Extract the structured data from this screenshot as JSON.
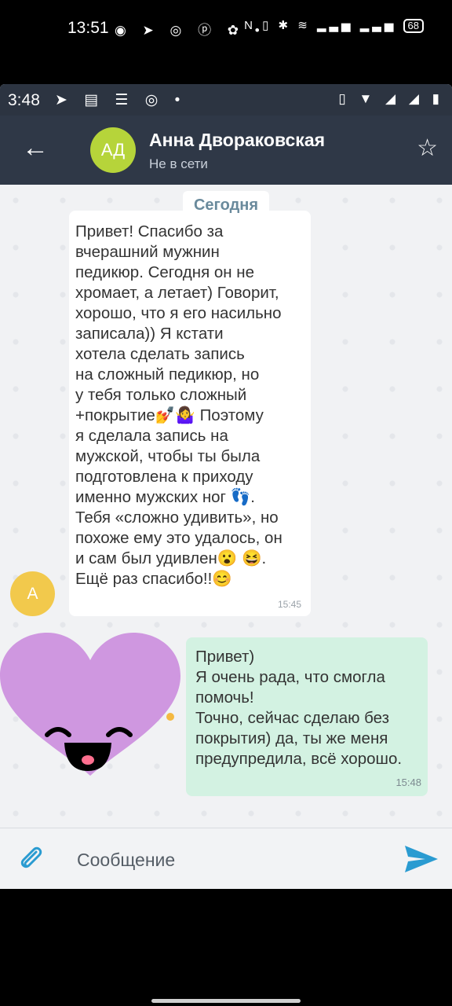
{
  "outer_status": {
    "time": "13:51",
    "icons": "◉ ➤ ◎ ⓟ ✿ •",
    "right_icons": "N ▯ ✱ ≋ ▂▃▅ ▂▃▅",
    "battery": "68"
  },
  "inner_status": {
    "time": "3:48",
    "icons": "➤ ▤ ☰ ◎ •",
    "right_icons": "▯ ▼ ◢ ◢ ▮"
  },
  "header": {
    "avatar_initials": "АД",
    "contact_name": "Анна Двораковская",
    "contact_status": "Не в сети",
    "back_icon": "arrow-left-icon",
    "star_icon": "star-outline-icon"
  },
  "chat": {
    "date_chip": "Сегодня",
    "incoming": {
      "avatar_initial": "А",
      "text": "Привет! Спасибо за\nвчерашний мужнин\nпедикюр. Сегодня он не\nхромает, а летает) Говорит,\nхорошо, что я его насильно\nзаписала)) Я кстати\nхотела сделать запись\nна сложный педикюр, но\nу тебя только сложный\n+покрытие💅🤷‍♀️ Поэтому\nя сделала запись на\nмужской, чтобы ты была\nподготовлена к приходу\nименно мужских ног 👣.\nТебя «сложно удивить», но\nпохоже ему это удалось, он\nи сам был удивлен😮 😆.\nЕщё раз спасибо!!😊",
      "time": "15:45"
    },
    "sticker": "smiling-heart-sticker",
    "outgoing": {
      "text": "Привет)\nЯ очень рада, что смогла\nпомочь!\nТочно, сейчас сделаю без\nпокрытия) да, ты же меня\nпредупредила, всё хорошо.",
      "time": "15:48"
    }
  },
  "composer": {
    "placeholder": "Сообщение",
    "attach_icon": "paperclip-icon",
    "send_icon": "send-icon",
    "accent": "#2a9bd1"
  },
  "colors": {
    "appbar": "#2f3847",
    "avatar": "#b6d43a",
    "outgoing_bubble": "#d3f2e2",
    "sticker": "#cf97e0"
  }
}
